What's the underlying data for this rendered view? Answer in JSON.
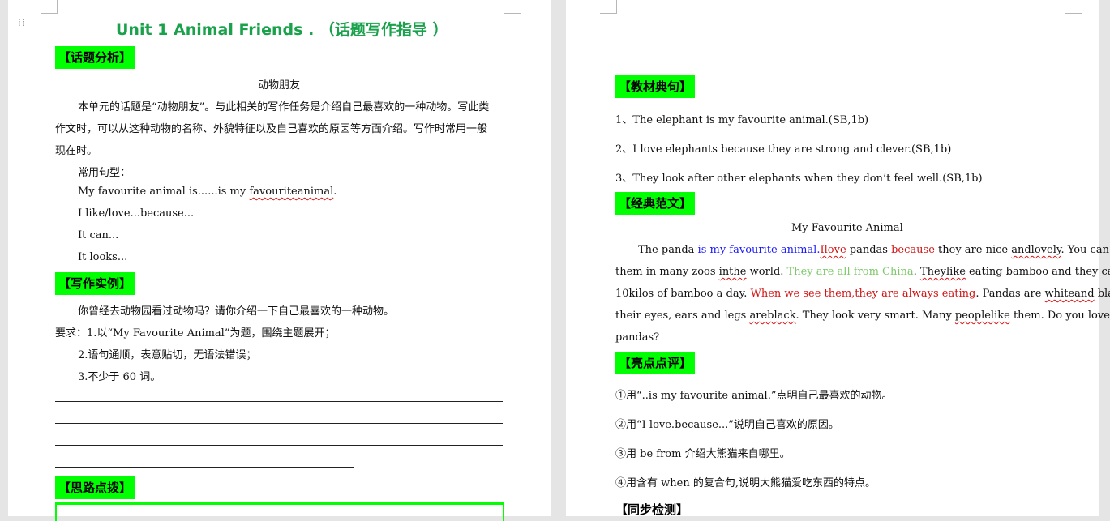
{
  "left": {
    "title": "Unit 1 Animal Friends .  （话题写作指导 ）",
    "h1": "【话题分析】",
    "topic_center": "动物朋友",
    "intro_p1": "本单元的话题是“动物朋友”。与此相关的写作任务是介绍自己最喜欢的一种动物。写此类",
    "intro_p2": "作文时，可以从这种动物的名称、外貌特征以及自己喜欢的原因等方面介绍。写作时常用一般",
    "intro_p3": "现在时。",
    "patterns_label": "常用句型：",
    "pattern1_a": "My favourite animal is......is my ",
    "pattern1_b": "favouriteanimal",
    "pattern1_c": ".",
    "pattern2": "I like/love...because...",
    "pattern3": "It can...",
    "pattern4": "It looks...",
    "h2": "【写作实例】",
    "task_q": "你曾经去动物园看过动物吗？请你介绍一下自己最喜欢的一种动物。",
    "req1": "要求：1.以“My Favourite Animal”为题，围绕主题展开；",
    "req2": "2.语句通顺，表意贴切，无语法错误；",
    "req3": "3.不少于 60 词。",
    "h3": "【思路点拨】"
  },
  "right": {
    "h1": "【教材典句】",
    "s1": "1、The elephant is my favourite animal.(SB,1b)",
    "s2": "2、I love elephants because they are strong and clever.(SB,1b)",
    "s3": "3、They look after other elephants when they don’t feel well.(SB,1b)",
    "h2": "【经典范文】",
    "essay_title": "My Favourite Animal",
    "e1_a": "The panda ",
    "e1_b": "is my favourite animal.",
    "e1_c": "Ilove",
    "e1_d": " pandas ",
    "e1_e": "because",
    "e1_f": " they are nice ",
    "e1_g": "andlovely",
    "e1_h": ". You can see",
    "e2_a": "them in many zoos ",
    "e2_b": "inthe",
    "e2_c": " world. ",
    "e2_d": "They are all from China",
    "e2_e": ". ",
    "e2_f": "Theylike",
    "e2_g": " eating bamboo and they can eat",
    "e3_a": "10kilos of bamboo a day. ",
    "e3_b": "When we see them,they are always eating",
    "e3_c": ". Pandas are ",
    "e3_d": "whiteand",
    "e3_e": " black and",
    "e4_a": "their eyes, ears and legs ",
    "e4_b": "areblack",
    "e4_c": ". They look very smart. Many ",
    "e4_d": "peoplelike",
    "e4_e": " them. Do you love",
    "e5": "pandas?",
    "h3": "【亮点点评】",
    "c1": "①用“..is my favourite animal.”点明自己最喜欢的动物。",
    "c2": "②用“I love.because...”说明自己喜欢的原因。",
    "c3": "③用 be from  介绍大熊猫来自哪里。",
    "c4": "④用含有 when 的复合句,说明大熊猫爱吃东西的特点。",
    "h4": "【同步检测】"
  },
  "colors": {
    "title": "#1aa14b",
    "highlight": "#00ff00",
    "blue": "#1a1aff",
    "red": "#d11414",
    "green": "#7ec86a"
  }
}
